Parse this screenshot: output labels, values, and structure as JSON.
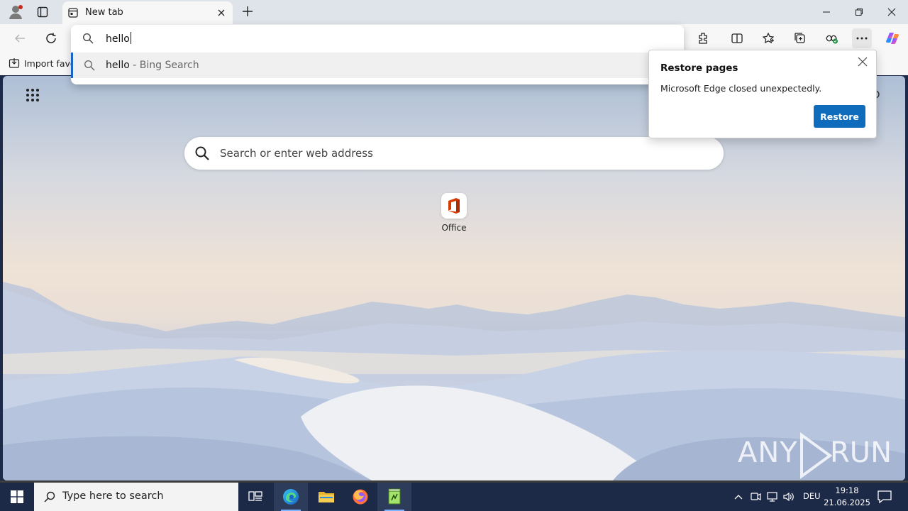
{
  "browser": {
    "tab_title": "New tab",
    "bookmarks_import_label": "Import favor",
    "address_value": "hello",
    "suggestion": {
      "query": "hello",
      "suffix": " - Bing Search"
    }
  },
  "ntp": {
    "search_placeholder": "Search or enter web address",
    "quick_links": [
      {
        "label": "Office",
        "icon": "office-icon"
      }
    ],
    "watermark": {
      "left": "ANY",
      "right": "RUN"
    }
  },
  "restore_popup": {
    "title": "Restore pages",
    "message": "Microsoft Edge closed unexpectedly.",
    "button_label": "Restore"
  },
  "taskbar": {
    "search_placeholder": "Type here to search",
    "language": "DEU",
    "time": "19:18",
    "date": "21.06.2025"
  },
  "colors": {
    "accent": "#0f6cbd",
    "taskbar": "#1d2a47",
    "titlebar": "#dfe3ea"
  }
}
